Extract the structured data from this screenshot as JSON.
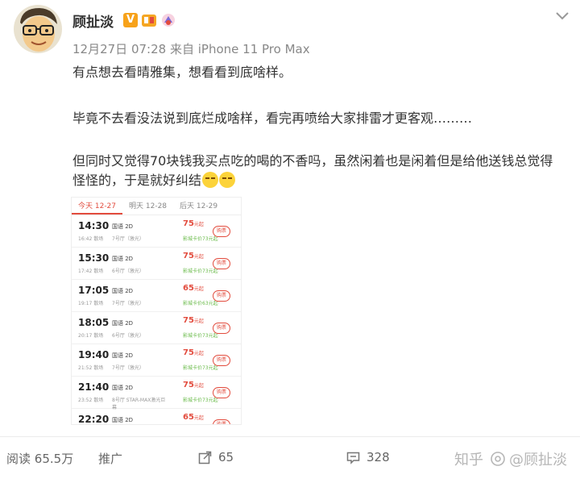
{
  "post": {
    "username": "顾扯淡",
    "verified_badge": "V",
    "date": "12月27日 07:28",
    "source_prefix": "来自",
    "source": "iPhone 11 Pro Max",
    "paragraphs": [
      "有点想去看晴雅集，想看看到底啥样。",
      "毕竟不去看没法说到底烂成啥样，看完再喷给大家排雷才更客观………",
      "但同时又觉得70块钱我买点吃的喝的不香吗，虽然闲着也是闲着但是给他送钱总觉得怪怪的，于是就好纠结"
    ]
  },
  "screenshot": {
    "tabs": [
      "今天 12-27",
      "明天 12-28",
      "后天 12-29"
    ],
    "sessions": [
      {
        "time": "14:30",
        "end": "16:42 散场",
        "type": "国语 2D",
        "hall": "7号厅（激光）",
        "price": "75",
        "unit": "元起",
        "card": "影城卡价73元起",
        "buy": "购票"
      },
      {
        "time": "15:30",
        "end": "17:42 散场",
        "type": "国语 2D",
        "hall": "6号厅（激光）",
        "price": "75",
        "unit": "元起",
        "card": "影城卡价73元起",
        "buy": "购票"
      },
      {
        "time": "17:05",
        "end": "19:17 散场",
        "type": "国语 2D",
        "hall": "7号厅（激光）",
        "price": "65",
        "unit": "元起",
        "card": "影城卡价63元起",
        "buy": "购票"
      },
      {
        "time": "18:05",
        "end": "20:17 散场",
        "type": "国语 2D",
        "hall": "6号厅（激光）",
        "price": "75",
        "unit": "元起",
        "card": "影城卡价73元起",
        "buy": "购票"
      },
      {
        "time": "19:40",
        "end": "21:52 散场",
        "type": "国语 2D",
        "hall": "7号厅（激光）",
        "price": "75",
        "unit": "元起",
        "card": "影城卡价73元起",
        "buy": "购票"
      },
      {
        "time": "21:40",
        "end": "23:52 散场",
        "type": "国语 2D",
        "hall": "8号厅 STAR-MAX激光巨幕",
        "price": "75",
        "unit": "元起",
        "card": "影城卡价73元起",
        "buy": "购票"
      },
      {
        "time": "22:20",
        "end": "",
        "type": "国语 2D",
        "hall": "",
        "price": "65",
        "unit": "元起",
        "card": "",
        "buy": "购票"
      }
    ]
  },
  "actions": {
    "reads_label": "阅读",
    "reads_count": "65.5万",
    "promote": "推广",
    "shares": "65",
    "comments": "328"
  },
  "watermark": {
    "site": "知乎",
    "author": "@顾扯淡"
  },
  "colors": {
    "accent_red": "#e24b3d",
    "verified_orange": "#f7a21a",
    "card_price_green": "#6abb4a"
  }
}
